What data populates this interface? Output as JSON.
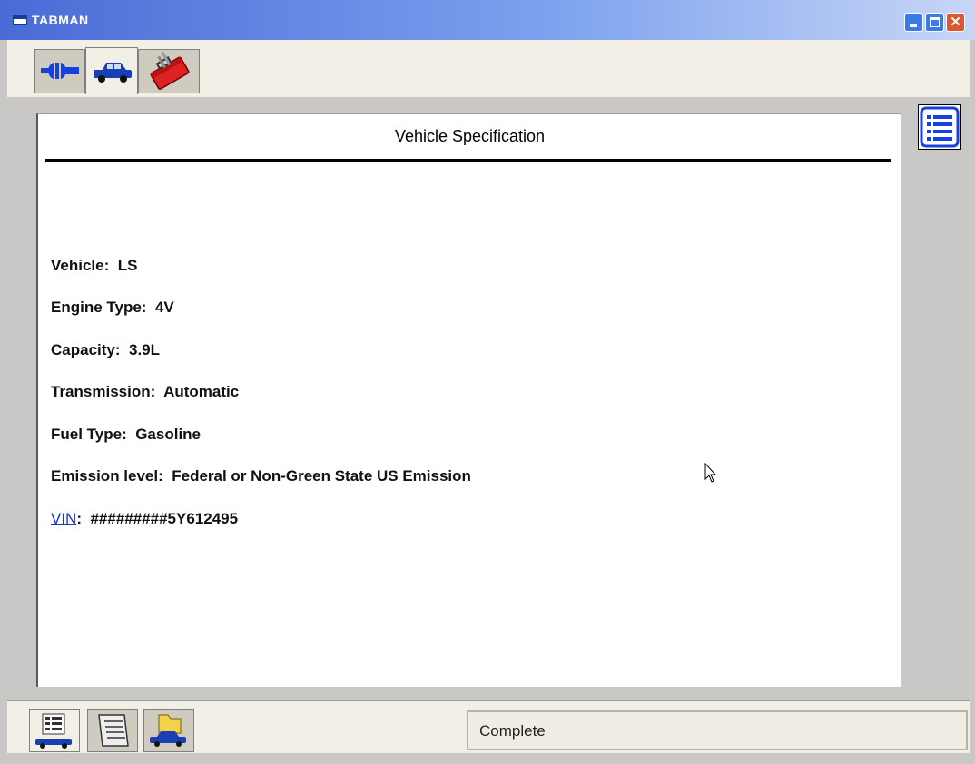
{
  "window": {
    "title": "TABMAN"
  },
  "top_tabs": [
    {
      "icon": "connector-icon"
    },
    {
      "icon": "vehicle-icon"
    },
    {
      "icon": "toolbox-icon"
    }
  ],
  "content": {
    "title": "Vehicle Specification",
    "rows": [
      {
        "label": "Vehicle:",
        "value": "LS"
      },
      {
        "label": "Engine Type:",
        "value": "4V"
      },
      {
        "label": "Capacity:",
        "value": "3.9L"
      },
      {
        "label": "Transmission:",
        "value": "Automatic"
      },
      {
        "label": "Fuel Type:",
        "value": "Gasoline"
      },
      {
        "label": "Emission level:",
        "value": "Federal or Non-Green State US Emission"
      }
    ],
    "vin": {
      "link_label": "VIN",
      "separator": ":",
      "value": "#########5Y612495"
    }
  },
  "bottom_tabs": [
    {
      "icon": "vehicle-data-icon"
    },
    {
      "icon": "document-scroll-icon"
    },
    {
      "icon": "vehicle-folder-icon"
    }
  ],
  "status": {
    "text": "Complete"
  },
  "colors": {
    "title_bar": "#4a6bd6",
    "link": "#1a33cc",
    "close_button": "#d9582f"
  }
}
